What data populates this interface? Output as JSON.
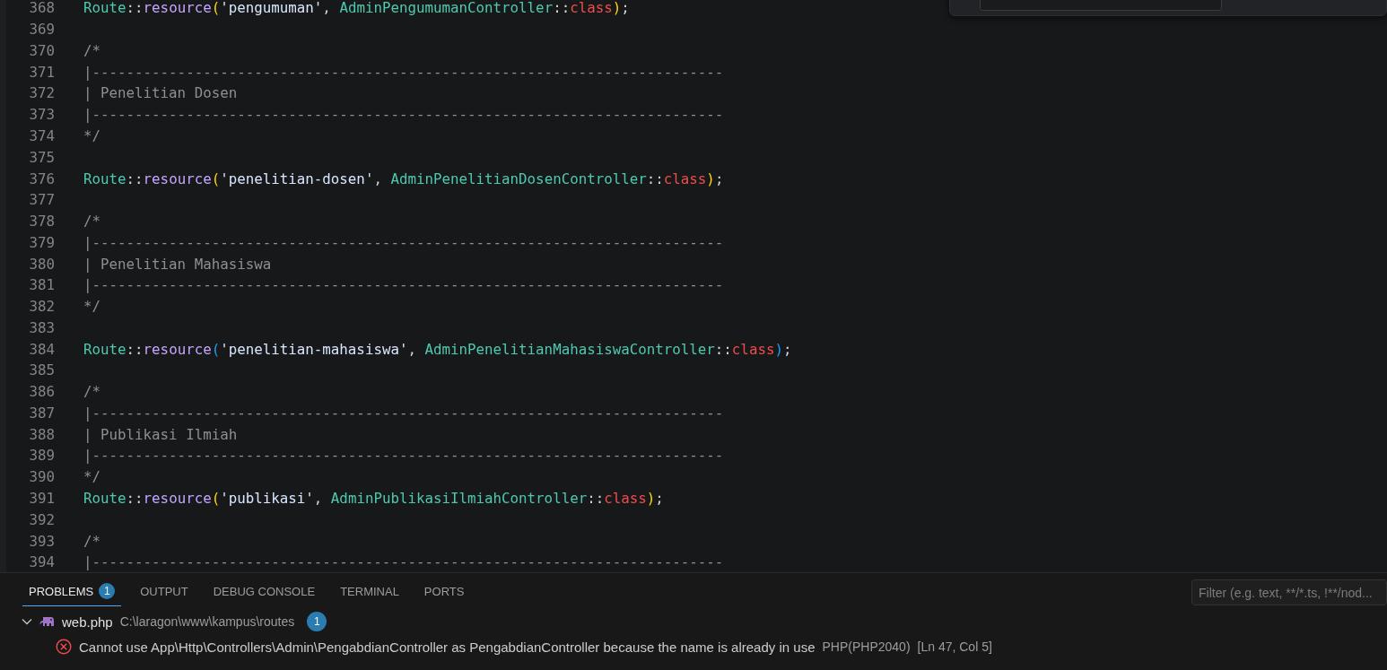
{
  "editor": {
    "lines": [
      {
        "number": "368",
        "tokens": [
          {
            "kind": "type",
            "text": "Route"
          },
          {
            "kind": "punct",
            "text": "::"
          },
          {
            "kind": "func",
            "text": "resource"
          },
          {
            "kind": "bracket",
            "color": "#ffd700",
            "text": "("
          },
          {
            "kind": "string",
            "text": "'pengumuman'"
          },
          {
            "kind": "punct",
            "text": ", "
          },
          {
            "kind": "type",
            "text": "AdminPengumumanController"
          },
          {
            "kind": "punct",
            "text": "::"
          },
          {
            "kind": "keyword",
            "text": "class"
          },
          {
            "kind": "bracket",
            "color": "#ffd700",
            "text": ")"
          },
          {
            "kind": "punct",
            "text": ";"
          }
        ]
      },
      {
        "number": "369"
      },
      {
        "number": "370",
        "tokens": [
          {
            "kind": "comment",
            "text": "/*"
          }
        ]
      },
      {
        "number": "371",
        "tokens": [
          {
            "kind": "comment",
            "text": "|--------------------------------------------------------------------------"
          }
        ]
      },
      {
        "number": "372",
        "tokens": [
          {
            "kind": "comment",
            "text": "| Penelitian Dosen"
          }
        ]
      },
      {
        "number": "373",
        "tokens": [
          {
            "kind": "comment",
            "text": "|--------------------------------------------------------------------------"
          }
        ]
      },
      {
        "number": "374",
        "tokens": [
          {
            "kind": "comment",
            "text": "*/"
          }
        ]
      },
      {
        "number": "375"
      },
      {
        "number": "376",
        "tokens": [
          {
            "kind": "type",
            "text": "Route"
          },
          {
            "kind": "punct",
            "text": "::"
          },
          {
            "kind": "func",
            "text": "resource"
          },
          {
            "kind": "bracket",
            "color": "#ffd700",
            "text": "("
          },
          {
            "kind": "string",
            "text": "'penelitian-dosen'"
          },
          {
            "kind": "punct",
            "text": ", "
          },
          {
            "kind": "type",
            "text": "AdminPenelitianDosenController"
          },
          {
            "kind": "punct",
            "text": "::"
          },
          {
            "kind": "keyword",
            "text": "class"
          },
          {
            "kind": "bracket",
            "color": "#ffd700",
            "text": ")"
          },
          {
            "kind": "punct",
            "text": ";"
          }
        ]
      },
      {
        "number": "377"
      },
      {
        "number": "378",
        "tokens": [
          {
            "kind": "comment",
            "text": "/*"
          }
        ]
      },
      {
        "number": "379",
        "tokens": [
          {
            "kind": "comment",
            "text": "|--------------------------------------------------------------------------"
          }
        ]
      },
      {
        "number": "380",
        "tokens": [
          {
            "kind": "comment",
            "text": "| Penelitian Mahasiswa"
          }
        ]
      },
      {
        "number": "381",
        "tokens": [
          {
            "kind": "comment",
            "text": "|--------------------------------------------------------------------------"
          }
        ]
      },
      {
        "number": "382",
        "tokens": [
          {
            "kind": "comment",
            "text": "*/"
          }
        ]
      },
      {
        "number": "383"
      },
      {
        "number": "384",
        "tokens": [
          {
            "kind": "type",
            "text": "Route"
          },
          {
            "kind": "punct",
            "text": "::"
          },
          {
            "kind": "func",
            "text": "resource"
          },
          {
            "kind": "bracket",
            "color": "#179fff",
            "text": "("
          },
          {
            "kind": "string",
            "text": "'penelitian-mahasiswa'"
          },
          {
            "kind": "punct",
            "text": ", "
          },
          {
            "kind": "type",
            "text": "AdminPenelitianMahasiswaController"
          },
          {
            "kind": "punct",
            "text": "::"
          },
          {
            "kind": "keyword",
            "text": "class"
          },
          {
            "kind": "bracket",
            "color": "#179fff",
            "text": ")"
          },
          {
            "kind": "punct",
            "text": ";"
          }
        ]
      },
      {
        "number": "385"
      },
      {
        "number": "386",
        "tokens": [
          {
            "kind": "comment",
            "text": "/*"
          }
        ]
      },
      {
        "number": "387",
        "tokens": [
          {
            "kind": "comment",
            "text": "|--------------------------------------------------------------------------"
          }
        ]
      },
      {
        "number": "388",
        "tokens": [
          {
            "kind": "comment",
            "text": "| Publikasi Ilmiah"
          }
        ]
      },
      {
        "number": "389",
        "tokens": [
          {
            "kind": "comment",
            "text": "|--------------------------------------------------------------------------"
          }
        ]
      },
      {
        "number": "390",
        "tokens": [
          {
            "kind": "comment",
            "text": "*/"
          }
        ]
      },
      {
        "number": "391",
        "tokens": [
          {
            "kind": "type",
            "text": "Route"
          },
          {
            "kind": "punct",
            "text": "::"
          },
          {
            "kind": "func",
            "text": "resource"
          },
          {
            "kind": "bracket",
            "color": "#ffd700",
            "text": "("
          },
          {
            "kind": "string",
            "text": "'publikasi'"
          },
          {
            "kind": "punct",
            "text": ", "
          },
          {
            "kind": "type",
            "text": "AdminPublikasiIlmiahController"
          },
          {
            "kind": "punct",
            "text": "::"
          },
          {
            "kind": "keyword",
            "text": "class"
          },
          {
            "kind": "bracket",
            "color": "#ffd700",
            "text": ")"
          },
          {
            "kind": "punct",
            "text": ";"
          }
        ]
      },
      {
        "number": "392"
      },
      {
        "number": "393",
        "tokens": [
          {
            "kind": "comment",
            "text": "/*"
          }
        ]
      },
      {
        "number": "394",
        "tokens": [
          {
            "kind": "comment",
            "text": "|--------------------------------------------------------------------------"
          }
        ]
      }
    ]
  },
  "panel": {
    "tabs": [
      {
        "label": "PROBLEMS",
        "selected": true,
        "badge": "1"
      },
      {
        "label": "OUTPUT",
        "selected": false
      },
      {
        "label": "DEBUG CONSOLE",
        "selected": false
      },
      {
        "label": "TERMINAL",
        "selected": false
      },
      {
        "label": "PORTS",
        "selected": false
      }
    ],
    "filter": {
      "placeholder": "Filter (e.g. text, **/*.ts, !**/nod..."
    },
    "problems": [
      {
        "file": "web.php",
        "path": "C:\\laragon\\www\\kampus\\routes",
        "count": "1",
        "expanded": true,
        "children": [
          {
            "message": "Cannot use App\\Http\\Controllers\\Admin\\PengabdianController as PengabdianController because the name is already in use",
            "source": "PHP(PHP2040)",
            "location": "[Ln 47, Col 5]"
          }
        ]
      }
    ]
  }
}
